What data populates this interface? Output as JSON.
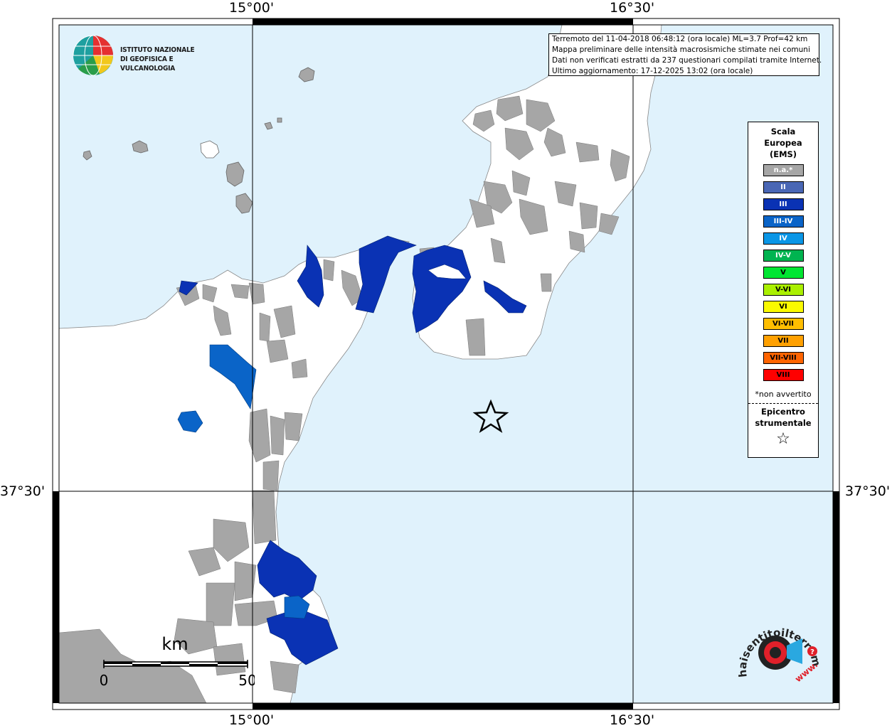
{
  "coords": {
    "top_lon_left": "15°00'",
    "top_lon_right": "16°30'",
    "bottom_lon_left": "15°00'",
    "bottom_lon_right": "16°30'",
    "left_lat": "37°30'",
    "right_lat": "37°30'"
  },
  "info": {
    "line1": "Terremoto del 11-04-2018 06:48:12 (ora locale) ML=3.7 Prof=42 km",
    "line2": "Mappa preliminare delle intensità macrosismiche stimate nei comuni",
    "line3": "Dati non verificati estratti da 237 questionari compilati tramite Internet.",
    "line4": "Ultimo aggiornamento: 17-12-2025 13:02 (ora locale)"
  },
  "logo": {
    "line1": "ISTITUTO NAZIONALE",
    "line2": "DI GEOFISICA E VULCANOLOGIA"
  },
  "legend": {
    "title1": "Scala",
    "title2": "Europea",
    "title3": "(EMS)",
    "classes": [
      {
        "label": "n.a.*",
        "color": "#a6a6a6",
        "text": "#ffffff"
      },
      {
        "label": "II",
        "color": "#4a67b5",
        "text": "#ffffff"
      },
      {
        "label": "III",
        "color": "#0a32b4",
        "text": "#ffffff"
      },
      {
        "label": "III-IV",
        "color": "#0a64c8",
        "text": "#ffffff"
      },
      {
        "label": "IV",
        "color": "#0a96e6",
        "text": "#ffffff"
      },
      {
        "label": "IV-V",
        "color": "#00b450",
        "text": "#ffffff"
      },
      {
        "label": "V",
        "color": "#00e632",
        "text": "#000000"
      },
      {
        "label": "V-VI",
        "color": "#aaf000",
        "text": "#000000"
      },
      {
        "label": "VI",
        "color": "#fafa00",
        "text": "#000000"
      },
      {
        "label": "VI-VII",
        "color": "#ffbe00",
        "text": "#000000"
      },
      {
        "label": "VII",
        "color": "#ffa000",
        "text": "#000000"
      },
      {
        "label": "VII-VIII",
        "color": "#ff6400",
        "text": "#000000"
      },
      {
        "label": "VIII",
        "color": "#ff0000",
        "text": "#000000"
      }
    ],
    "na_note": "*non avvertito",
    "epicenter_line1": "Epicentro",
    "epicenter_line2": "strumentale",
    "epicenter_symbol": "☆"
  },
  "scalebar": {
    "unit": "km",
    "start": "0",
    "end": "50"
  },
  "hsit": {
    "text": "haisentitoilterremoto.it",
    "www": "www."
  },
  "colors": {
    "sea": "#e0f2fc",
    "land": "#ffffff",
    "na": "#a6a6a6",
    "iii": "#0a32b4",
    "iii_iv": "#0a64c8"
  }
}
